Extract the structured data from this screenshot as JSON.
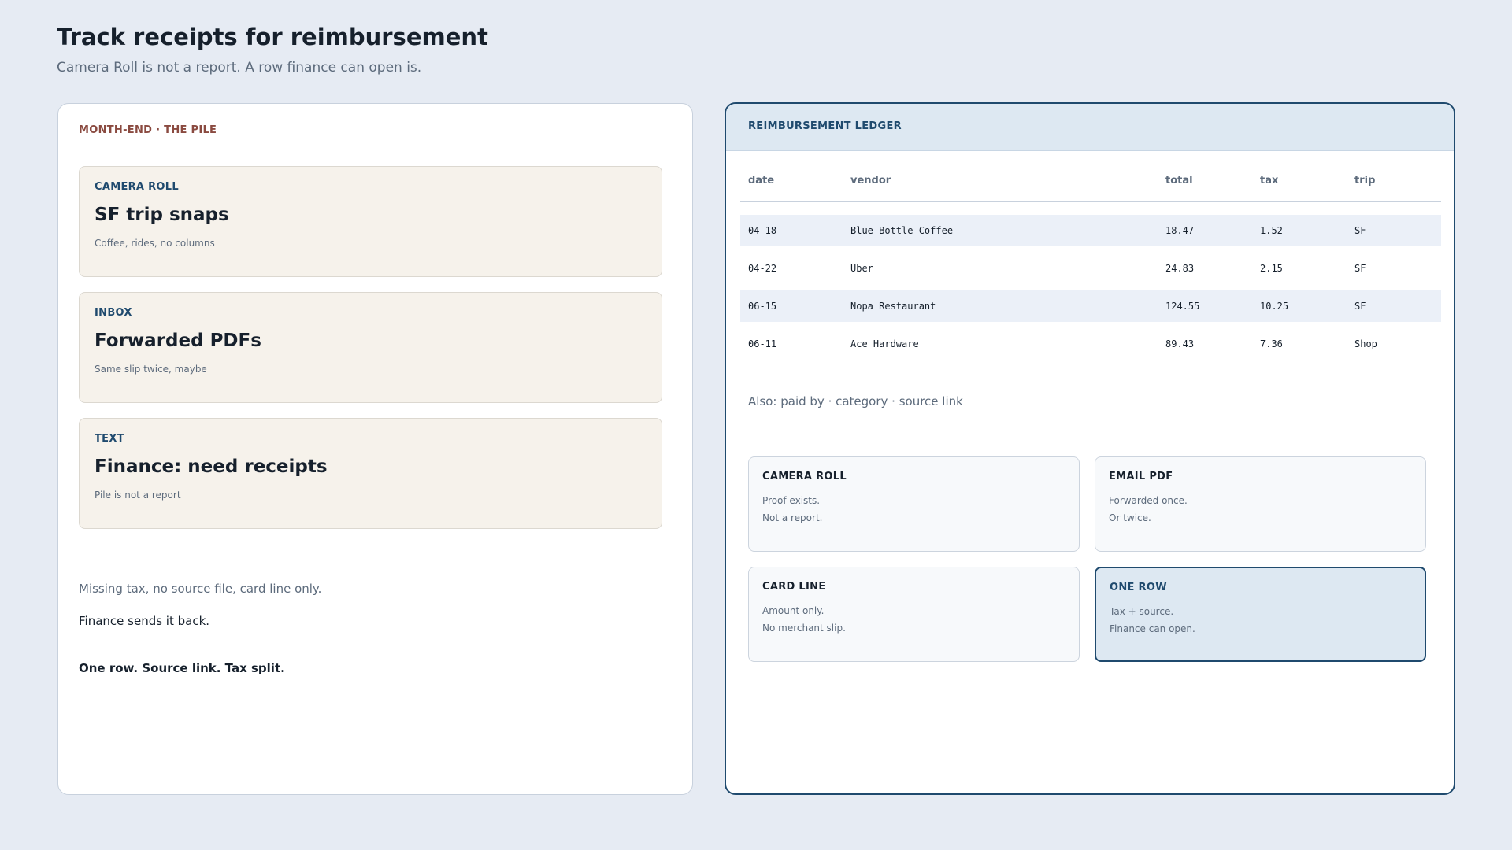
{
  "header": {
    "title": "Track receipts for reimbursement",
    "subtitle": "Camera Roll is not a report. A row finance can open is."
  },
  "pile": {
    "kicker": "MONTH-END · THE PILE",
    "cards": [
      {
        "kicker": "CAMERA ROLL",
        "title": "SF trip snaps",
        "note": "Coffee, rides, no columns"
      },
      {
        "kicker": "INBOX",
        "title": "Forwarded PDFs",
        "note": "Same slip twice, maybe"
      },
      {
        "kicker": "TEXT",
        "title": "Finance: need receipts",
        "note": "Pile is not a report"
      }
    ],
    "note_missing": "Missing tax, no source file, card line only.",
    "note_sendback": "Finance sends it back.",
    "note_fix": "One row. Source link. Tax split."
  },
  "ledger": {
    "title": "REIMBURSEMENT LEDGER",
    "columns": [
      "date",
      "vendor",
      "total",
      "tax",
      "trip"
    ],
    "rows": [
      {
        "date": "04-18",
        "vendor": "Blue Bottle Coffee",
        "total": "18.47",
        "tax": "1.52",
        "trip": "SF"
      },
      {
        "date": "04-22",
        "vendor": "Uber",
        "total": "24.83",
        "tax": "2.15",
        "trip": "SF"
      },
      {
        "date": "06-15",
        "vendor": "Nopa Restaurant",
        "total": "124.55",
        "tax": "10.25",
        "trip": "SF"
      },
      {
        "date": "06-11",
        "vendor": "Ace Hardware",
        "total": "89.43",
        "tax": "7.36",
        "trip": "Shop"
      }
    ],
    "also": "Also: paid by · category · source link"
  },
  "sources": [
    {
      "label": "CAMERA ROLL",
      "line1": "Proof exists.",
      "line2": "Not a report.",
      "active": false
    },
    {
      "label": "EMAIL PDF",
      "line1": "Forwarded once.",
      "line2": "Or twice.",
      "active": false
    },
    {
      "label": "CARD LINE",
      "line1": "Amount only.",
      "line2": "No merchant slip.",
      "active": false
    },
    {
      "label": "ONE ROW",
      "line1": "Tax + source.",
      "line2": "Finance can open.",
      "active": true
    }
  ],
  "colors": {
    "background": "#e6ebf3",
    "accent": "#1f4a6e",
    "pile_kicker": "#8a4a40",
    "pile_card": "#f6f2eb",
    "row_shade": "#ebf0f8"
  }
}
